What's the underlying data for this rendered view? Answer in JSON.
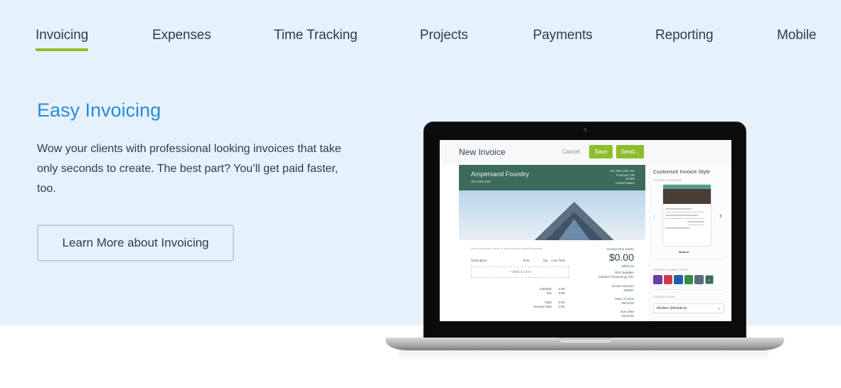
{
  "nav": {
    "items": [
      {
        "label": "Invoicing",
        "active": true
      },
      {
        "label": "Expenses",
        "active": false
      },
      {
        "label": "Time Tracking",
        "active": false
      },
      {
        "label": "Projects",
        "active": false
      },
      {
        "label": "Payments",
        "active": false
      },
      {
        "label": "Reporting",
        "active": false
      },
      {
        "label": "Mobile",
        "active": false
      }
    ]
  },
  "hero": {
    "title": "Easy Invoicing",
    "description": "Wow your clients with professional looking invoices that take only seconds to create. The best part? You’ll get paid faster, too.",
    "cta_label": "Learn More about Invoicing"
  },
  "colors": {
    "accent_green": "#94b92a",
    "title_blue": "#2b8ad6",
    "hero_bg": "#e5f2fc",
    "invoice_banner": "#3c6b5c"
  },
  "screen": {
    "page_title": "New Invoice",
    "cancel_label": "Cancel",
    "save_label": "Save",
    "send_label": "Send...",
    "invoice": {
      "company": "Ampersand Foundry",
      "phone": "202-555-0118",
      "address_lines": [
        "224 NW 13th Ave",
        "Portland, OR",
        "97209",
        "United States"
      ],
      "notes_placeholder": "Add a summary, notes, or bank transfer details (optional)",
      "amount_due_label": "Amount Due (USD)",
      "amount_due": "$0.00",
      "columns": [
        "Description",
        "Rate",
        "Qty",
        "Line Total"
      ],
      "add_line_label": "+ Add a Line",
      "totals": [
        {
          "label": "Subtotal",
          "value": "0.00"
        },
        {
          "label": "Tax",
          "value": "0.00"
        },
        {
          "label": "Total",
          "value": "0.00"
        },
        {
          "label": "Amount Paid",
          "value": "0.00"
        }
      ],
      "billed_to_label": "Billed To",
      "billed_to": [
        "Rick Sanders",
        "Garden Contracting LTD."
      ],
      "invoice_number_label": "Invoice Number",
      "invoice_number": "100207",
      "date_of_issue_label": "Date of Issue",
      "date_of_issue": "09/12/16",
      "due_date_label": "Due Date",
      "due_date": "10/12/16"
    },
    "sidebar": {
      "title": "Customize Invoice Style",
      "template_label": "CHOOSE A TEMPLATE",
      "template_name": "Modern",
      "theme_label": "CHOOSE A THEME COLOR",
      "theme_colors": [
        "#6a3fa0",
        "#d23a48",
        "#1e5fae",
        "#3a8a48",
        "#5a6b7a",
        "#3c6b5c"
      ],
      "selected_theme_index": 5,
      "font_label": "CHOOSE A FONT",
      "font_value": "Modern (Helvetica)"
    }
  }
}
